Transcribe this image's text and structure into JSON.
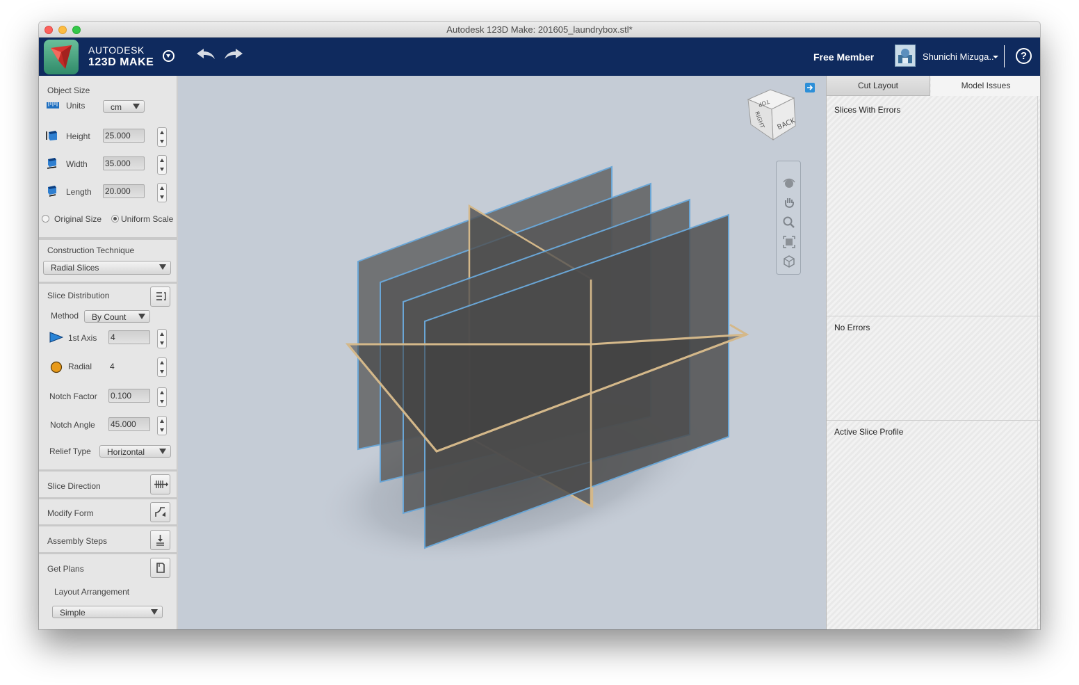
{
  "window": {
    "title": "Autodesk 123D Make: 201605_laundrybox.stl*"
  },
  "header": {
    "brand_line1": "AUTODESK",
    "brand_line2": "123D MAKE",
    "membership": "Free Member",
    "user_name": "Shunichi Mizuga..",
    "help_glyph": "?",
    "icons": [
      "logo-icon",
      "brand-menu-icon",
      "undo-icon",
      "redo-icon",
      "user-avatar-icon",
      "user-menu-caret-icon",
      "help-icon"
    ],
    "colors": {
      "bar": "#0f2a5e",
      "logo": "#3a9c78"
    }
  },
  "left_panel": {
    "object_size": {
      "title": "Object Size",
      "units_label": "Units",
      "units_value": "cm",
      "height_label": "Height",
      "height_value": "25.000",
      "width_label": "Width",
      "width_value": "35.000",
      "length_label": "Length",
      "length_value": "20.000",
      "original_size_label": "Original Size",
      "uniform_scale_label": "Uniform Scale",
      "selected_scale": "Uniform Scale"
    },
    "construction": {
      "title": "Construction Technique",
      "technique": "Radial Slices"
    },
    "slice_distribution": {
      "title": "Slice Distribution",
      "method_label": "Method",
      "method_value": "By Count",
      "axis_label": "1st Axis",
      "axis_value": "4",
      "radial_label": "Radial",
      "radial_value": "4",
      "notch_factor_label": "Notch Factor",
      "notch_factor_value": "0.100",
      "notch_angle_label": "Notch Angle",
      "notch_angle_value": "45.000",
      "relief_type_label": "Relief Type",
      "relief_type_value": "Horizontal"
    },
    "sections": {
      "slice_direction": "Slice Direction",
      "modify_form": "Modify Form",
      "assembly_steps": "Assembly Steps",
      "get_plans": "Get Plans"
    },
    "layout": {
      "label": "Layout Arrangement",
      "value": "Simple"
    }
  },
  "viewport": {
    "viewcube_faces": {
      "top": "TOP",
      "right": "RIGHT",
      "back": "BACK"
    },
    "nav_tools": [
      "orbit-icon",
      "pan-icon",
      "zoom-icon",
      "zoom-fit-icon",
      "home-view-icon"
    ],
    "colors": {
      "background": "#c5ccd6",
      "slice_fill": "#505050",
      "slice_edge": "#5b9cc9",
      "radial_edge": "#d4b88a"
    }
  },
  "right_panel": {
    "tabs": [
      "Cut Layout",
      "Model Issues"
    ],
    "active_tab": "Model Issues",
    "slices_with_errors_label": "Slices With Errors",
    "no_errors_label": "No Errors",
    "active_slice_profile_label": "Active Slice Profile"
  }
}
